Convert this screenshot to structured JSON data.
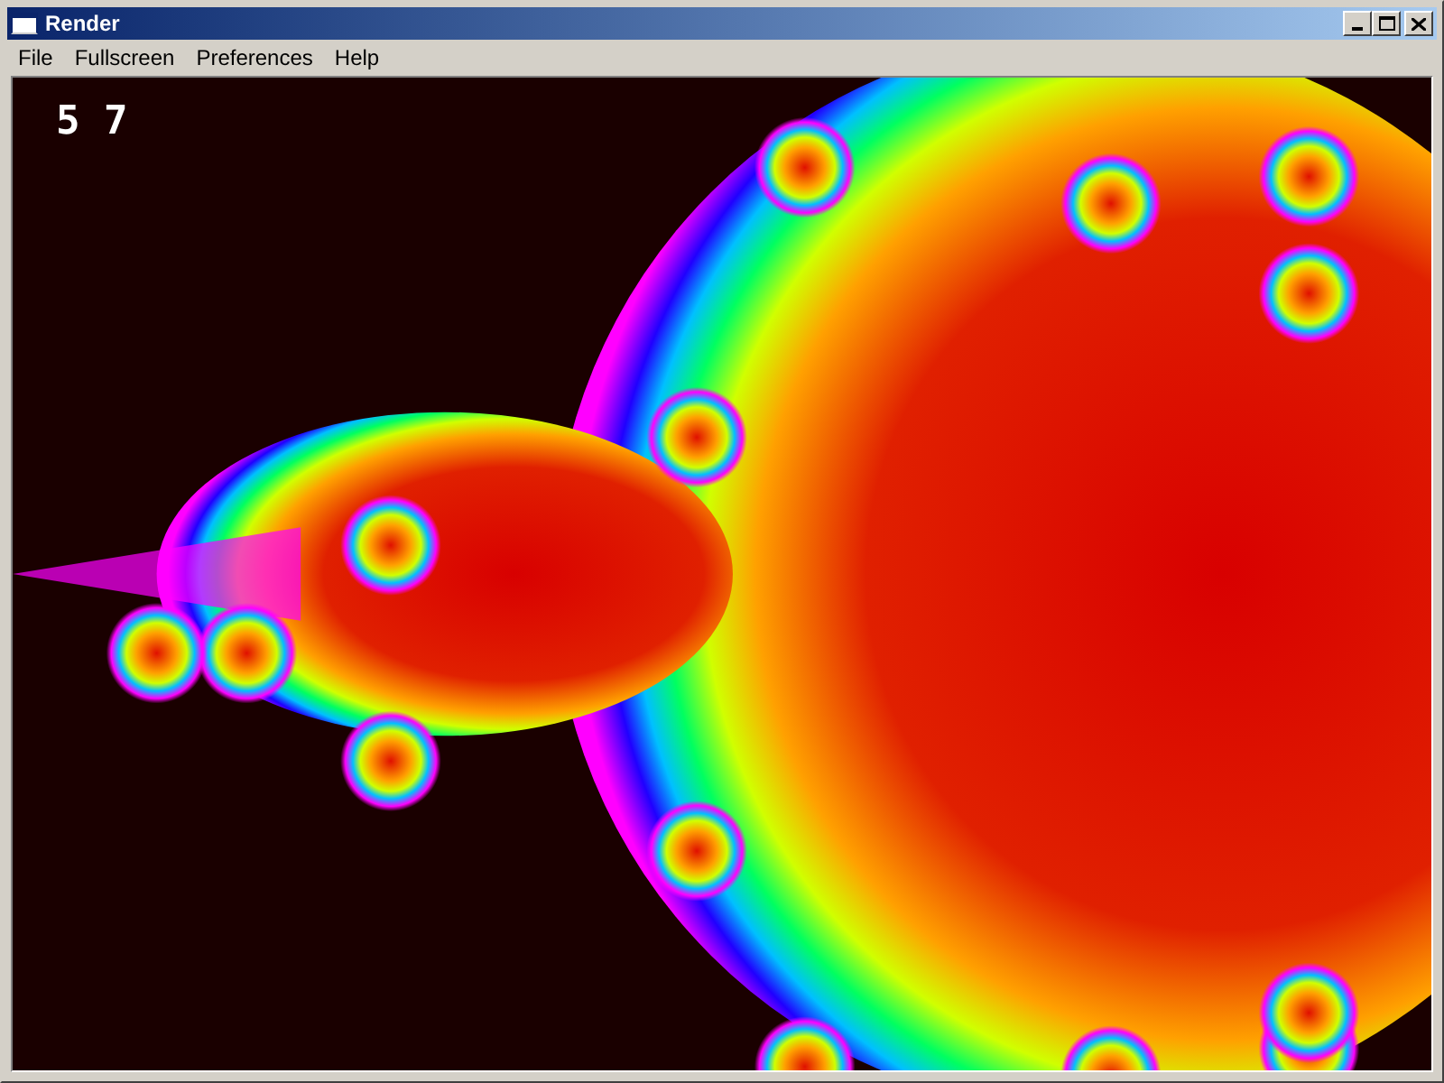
{
  "window": {
    "title": "Render"
  },
  "menu": [
    "File",
    "Fullscreen",
    "Preferences",
    "Help"
  ],
  "render": {
    "overlay_text": "5 7"
  }
}
